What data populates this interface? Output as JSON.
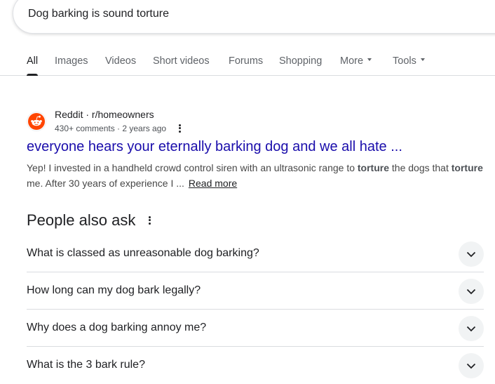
{
  "search": {
    "query": "Dog barking is sound torture"
  },
  "tabs": [
    {
      "label": "All"
    },
    {
      "label": "Images"
    },
    {
      "label": "Videos"
    },
    {
      "label": "Short videos"
    },
    {
      "label": "Forums"
    },
    {
      "label": "Shopping"
    },
    {
      "label": "More"
    },
    {
      "label": "Tools"
    }
  ],
  "result": {
    "icon": "reddit-icon",
    "site": "Reddit · r/homeowners",
    "meta": "430+ comments · 2 years ago",
    "title": "everyone hears your eternally barking dog and we all hate ...",
    "snippet_1": "Yep! I invested in a handheld crowd control siren with an ultrasonic range to ",
    "snippet_bold_1": "torture",
    "snippet_2": " the dogs that ",
    "snippet_bold_2": "torture",
    "snippet_3": " me. After 30 years of experience I ...",
    "read_more": "Read more"
  },
  "people_also_ask": {
    "heading": "People also ask",
    "questions": [
      "What is classed as unreasonable dog barking?",
      "How long can my dog bark legally?",
      "Why does a dog barking annoy me?",
      "What is the 3 bark rule?"
    ]
  },
  "colors": {
    "link": "#1a0dab",
    "reddit_orange": "#ff4500",
    "text": "#202124",
    "muted": "#5f6368"
  }
}
